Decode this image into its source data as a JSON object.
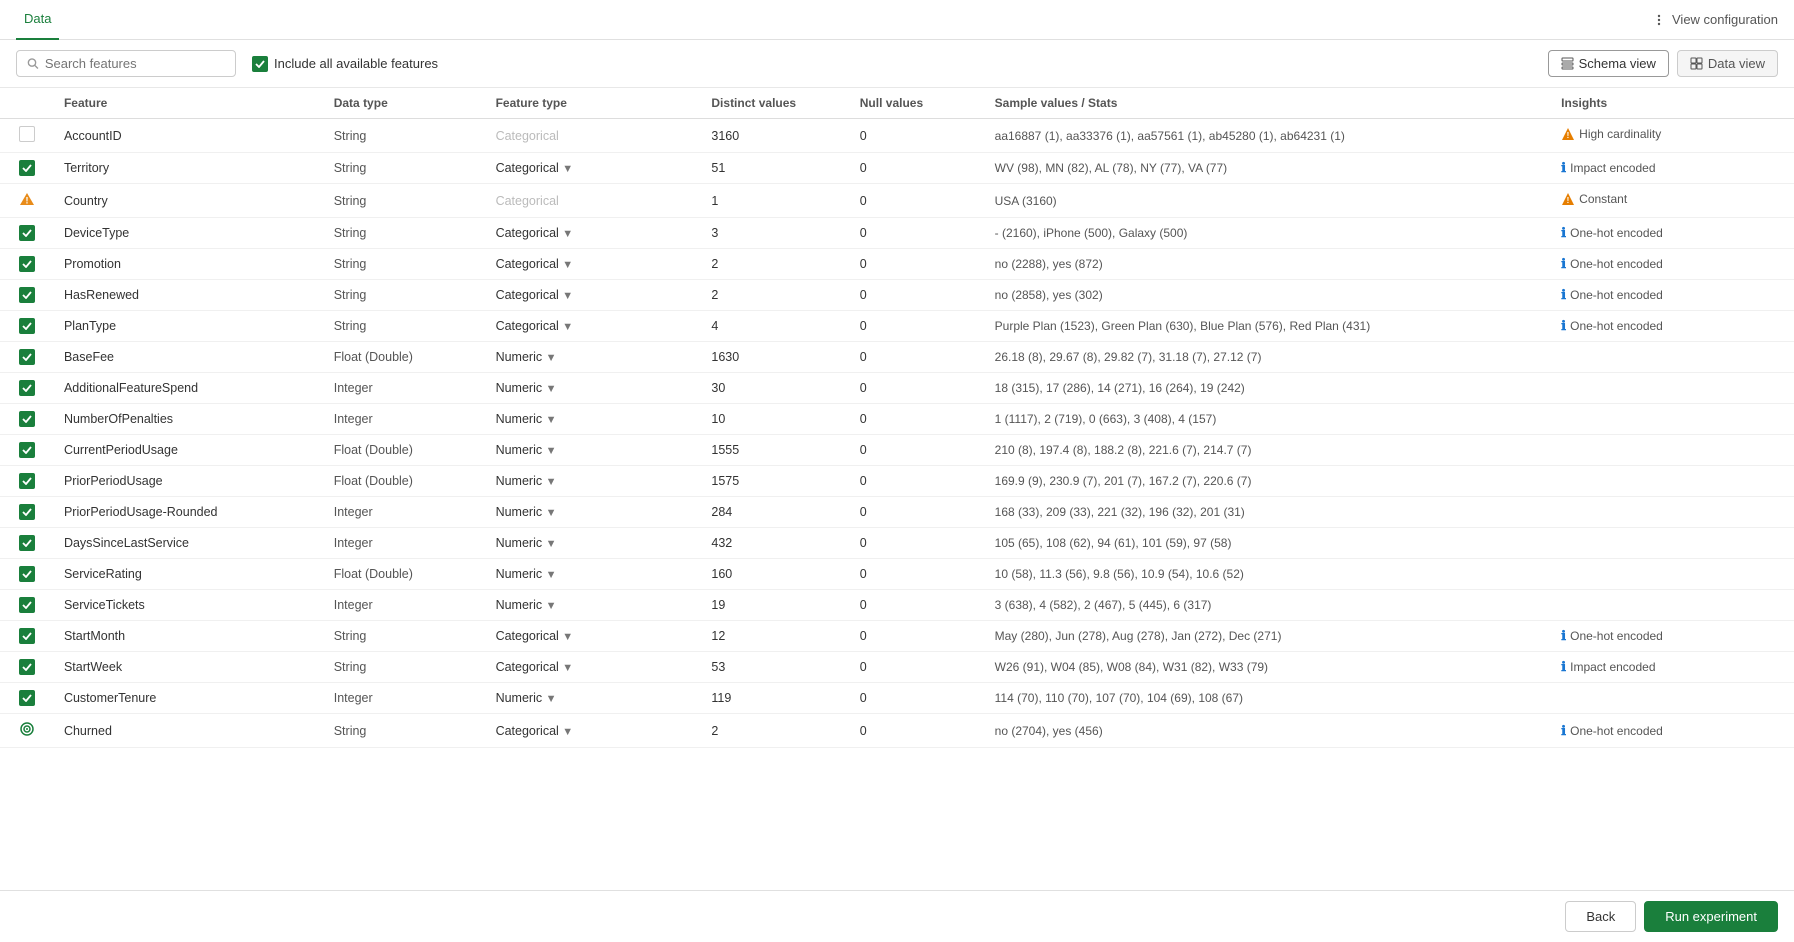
{
  "nav": {
    "tab_data": "Data",
    "view_config_label": "View configuration"
  },
  "toolbar": {
    "search_placeholder": "Search features",
    "include_label": "Include all available features",
    "schema_view_label": "Schema view",
    "data_view_label": "Data view"
  },
  "table": {
    "headers": [
      "",
      "Feature",
      "Data type",
      "Feature type",
      "Distinct values",
      "Null values",
      "Sample values / Stats",
      "Insights"
    ],
    "rows": [
      {
        "checked": "empty",
        "feature": "AccountID",
        "data_type": "String",
        "feature_type": "Categorical",
        "feature_type_gray": true,
        "distinct": "3160",
        "null": "0",
        "sample": "aa16887 (1), aa33376 (1), aa57561 (1), ab45280 (1), ab64231 (1)",
        "insight_icon": "warn",
        "insight_text": "High cardinality"
      },
      {
        "checked": "green",
        "feature": "Territory",
        "data_type": "String",
        "feature_type": "Categorical",
        "feature_type_gray": false,
        "distinct": "51",
        "null": "0",
        "sample": "WV (98), MN (82), AL (78), NY (77), VA (77)",
        "insight_icon": "info",
        "insight_text": "Impact encoded"
      },
      {
        "checked": "warn",
        "feature": "Country",
        "data_type": "String",
        "feature_type": "Categorical",
        "feature_type_gray": true,
        "distinct": "1",
        "null": "0",
        "sample": "USA (3160)",
        "insight_icon": "warn",
        "insight_text": "Constant"
      },
      {
        "checked": "green",
        "feature": "DeviceType",
        "data_type": "String",
        "feature_type": "Categorical",
        "feature_type_gray": false,
        "distinct": "3",
        "null": "0",
        "sample": "- (2160), iPhone (500), Galaxy (500)",
        "insight_icon": "info",
        "insight_text": "One-hot encoded"
      },
      {
        "checked": "green",
        "feature": "Promotion",
        "data_type": "String",
        "feature_type": "Categorical",
        "feature_type_gray": false,
        "distinct": "2",
        "null": "0",
        "sample": "no (2288), yes (872)",
        "insight_icon": "info",
        "insight_text": "One-hot encoded"
      },
      {
        "checked": "green",
        "feature": "HasRenewed",
        "data_type": "String",
        "feature_type": "Categorical",
        "feature_type_gray": false,
        "distinct": "2",
        "null": "0",
        "sample": "no (2858), yes (302)",
        "insight_icon": "info",
        "insight_text": "One-hot encoded"
      },
      {
        "checked": "green",
        "feature": "PlanType",
        "data_type": "String",
        "feature_type": "Categorical",
        "feature_type_gray": false,
        "distinct": "4",
        "null": "0",
        "sample": "Purple Plan (1523), Green Plan (630), Blue Plan (576), Red Plan (431)",
        "insight_icon": "info",
        "insight_text": "One-hot encoded"
      },
      {
        "checked": "green",
        "feature": "BaseFee",
        "data_type": "Float (Double)",
        "feature_type": "Numeric",
        "feature_type_gray": false,
        "distinct": "1630",
        "null": "0",
        "sample": "26.18 (8), 29.67 (8), 29.82 (7), 31.18 (7), 27.12 (7)",
        "insight_icon": null,
        "insight_text": ""
      },
      {
        "checked": "green",
        "feature": "AdditionalFeatureSpend",
        "data_type": "Integer",
        "feature_type": "Numeric",
        "feature_type_gray": false,
        "distinct": "30",
        "null": "0",
        "sample": "18 (315), 17 (286), 14 (271), 16 (264), 19 (242)",
        "insight_icon": null,
        "insight_text": ""
      },
      {
        "checked": "green",
        "feature": "NumberOfPenalties",
        "data_type": "Integer",
        "feature_type": "Numeric",
        "feature_type_gray": false,
        "distinct": "10",
        "null": "0",
        "sample": "1 (1117), 2 (719), 0 (663), 3 (408), 4 (157)",
        "insight_icon": null,
        "insight_text": ""
      },
      {
        "checked": "green",
        "feature": "CurrentPeriodUsage",
        "data_type": "Float (Double)",
        "feature_type": "Numeric",
        "feature_type_gray": false,
        "distinct": "1555",
        "null": "0",
        "sample": "210 (8), 197.4 (8), 188.2 (8), 221.6 (7), 214.7 (7)",
        "insight_icon": null,
        "insight_text": ""
      },
      {
        "checked": "green",
        "feature": "PriorPeriodUsage",
        "data_type": "Float (Double)",
        "feature_type": "Numeric",
        "feature_type_gray": false,
        "distinct": "1575",
        "null": "0",
        "sample": "169.9 (9), 230.9 (7), 201 (7), 167.2 (7), 220.6 (7)",
        "insight_icon": null,
        "insight_text": ""
      },
      {
        "checked": "green",
        "feature": "PriorPeriodUsage-Rounded",
        "data_type": "Integer",
        "feature_type": "Numeric",
        "feature_type_gray": false,
        "distinct": "284",
        "null": "0",
        "sample": "168 (33), 209 (33), 221 (32), 196 (32), 201 (31)",
        "insight_icon": null,
        "insight_text": ""
      },
      {
        "checked": "green",
        "feature": "DaysSinceLastService",
        "data_type": "Integer",
        "feature_type": "Numeric",
        "feature_type_gray": false,
        "distinct": "432",
        "null": "0",
        "sample": "105 (65), 108 (62), 94 (61), 101 (59), 97 (58)",
        "insight_icon": null,
        "insight_text": ""
      },
      {
        "checked": "green",
        "feature": "ServiceRating",
        "data_type": "Float (Double)",
        "feature_type": "Numeric",
        "feature_type_gray": false,
        "distinct": "160",
        "null": "0",
        "sample": "10 (58), 11.3 (56), 9.8 (56), 10.9 (54), 10.6 (52)",
        "insight_icon": null,
        "insight_text": ""
      },
      {
        "checked": "green",
        "feature": "ServiceTickets",
        "data_type": "Integer",
        "feature_type": "Numeric",
        "feature_type_gray": false,
        "distinct": "19",
        "null": "0",
        "sample": "3 (638), 4 (582), 2 (467), 5 (445), 6 (317)",
        "insight_icon": null,
        "insight_text": ""
      },
      {
        "checked": "green",
        "feature": "StartMonth",
        "data_type": "String",
        "feature_type": "Categorical",
        "feature_type_gray": false,
        "distinct": "12",
        "null": "0",
        "sample": "May (280), Jun (278), Aug (278), Jan (272), Dec (271)",
        "insight_icon": "info",
        "insight_text": "One-hot encoded"
      },
      {
        "checked": "green",
        "feature": "StartWeek",
        "data_type": "String",
        "feature_type": "Categorical",
        "feature_type_gray": false,
        "distinct": "53",
        "null": "0",
        "sample": "W26 (91), W04 (85), W08 (84), W31 (82), W33 (79)",
        "insight_icon": "info",
        "insight_text": "Impact encoded"
      },
      {
        "checked": "green",
        "feature": "CustomerTenure",
        "data_type": "Integer",
        "feature_type": "Numeric",
        "feature_type_gray": false,
        "distinct": "119",
        "null": "0",
        "sample": "114 (70), 110 (70), 107 (70), 104 (69), 108 (67)",
        "insight_icon": null,
        "insight_text": ""
      },
      {
        "checked": "target",
        "feature": "Churned",
        "data_type": "String",
        "feature_type": "Categorical",
        "feature_type_gray": false,
        "distinct": "2",
        "null": "0",
        "sample": "no (2704), yes (456)",
        "insight_icon": "info",
        "insight_text": "One-hot encoded"
      }
    ]
  },
  "bottom": {
    "back_label": "Back",
    "run_label": "Run experiment"
  }
}
